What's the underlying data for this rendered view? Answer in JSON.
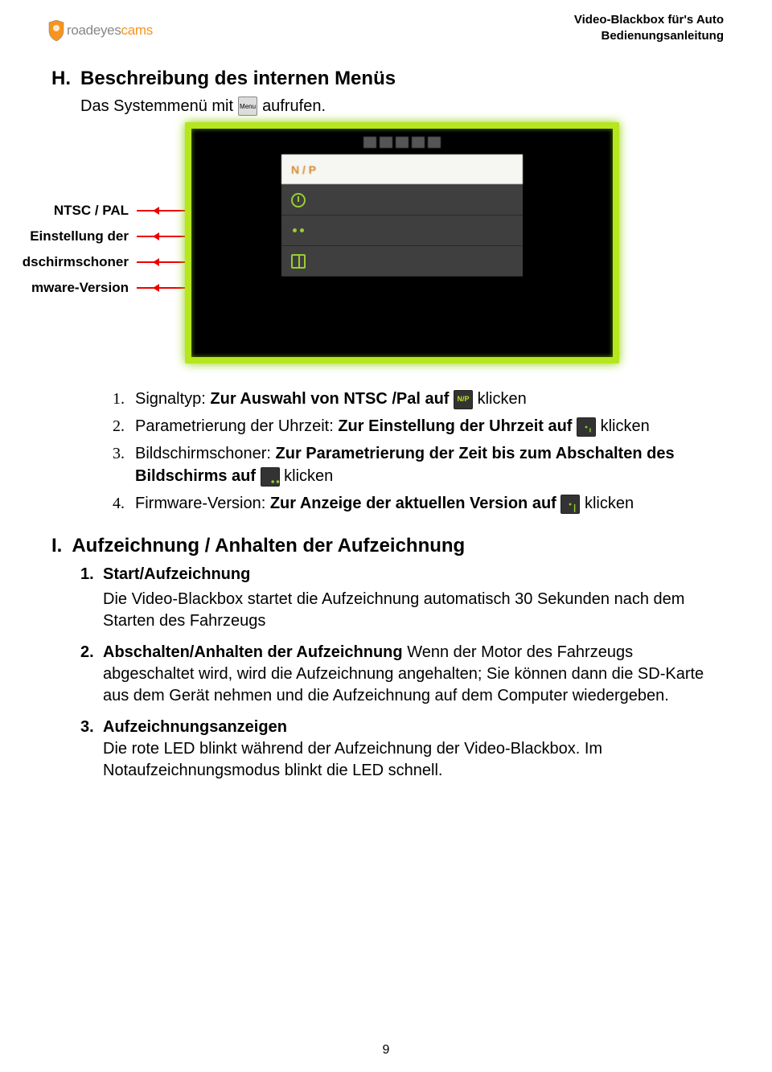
{
  "header": {
    "line1": "Video-Blackbox für's Auto",
    "line2": "Bedienungsanleitung",
    "logo_grey": "roadeyes",
    "logo_orange": "cams"
  },
  "sectionH": {
    "letter": "H.",
    "title": "Beschreibung des internen Menüs",
    "intro_before": "Das Systemmenü mit",
    "intro_after": "aufrufen.",
    "menu_icon_label": "Menu"
  },
  "callouts": {
    "ntsc": "NTSC / PAL",
    "uhrzeit": "Einstellung der",
    "schoner": "dschirmschoner",
    "firmware": "mware-Version"
  },
  "device": {
    "selected_label": "N / P"
  },
  "listH": [
    {
      "n": "1.",
      "before": "Signaltyp: ",
      "bold": "Zur Auswahl von NTSC /Pal auf",
      "after": "klicken",
      "icon": "N/P"
    },
    {
      "n": "2.",
      "before": "Parametrierung der Uhrzeit: ",
      "bold": "Zur Einstellung der Uhrzeit auf",
      "after": "klicken",
      "icon": "clock"
    },
    {
      "n": "3.",
      "before": "Bildschirmschoner: ",
      "bold": "Zur Parametrierung der Zeit bis zum Abschalten des Bildschirms auf",
      "after": "klicken",
      "icon": "dots"
    },
    {
      "n": "4.",
      "before": "Firmware-Version: ",
      "bold": "Zur Anzeige der aktuellen Version auf",
      "after": "klicken",
      "icon": "book"
    }
  ],
  "sectionI": {
    "letter": "I.",
    "title": "Aufzeichnung / Anhalten der Aufzeichnung"
  },
  "listI": [
    {
      "n": "1.",
      "title": "Start/Aufzeichnung",
      "body": "Die Video-Blackbox startet die Aufzeichnung automatisch 30 Sekunden nach dem Starten des Fahrzeugs"
    },
    {
      "n": "2.",
      "title": "Abschalten/Anhalten der Aufzeichnung",
      "body": "Wenn der Motor des Fahrzeugs abgeschaltet wird, wird die Aufzeichnung angehalten; Sie können dann die SD-Karte aus dem Gerät nehmen und die Aufzeichnung auf dem Computer wiedergeben."
    },
    {
      "n": "3.",
      "title": "Aufzeichnungsanzeigen",
      "body": "Die rote LED blinkt während der Aufzeichnung der Video-Blackbox. Im Notaufzeichnungsmodus blinkt die LED schnell."
    }
  ],
  "page_number": "9"
}
